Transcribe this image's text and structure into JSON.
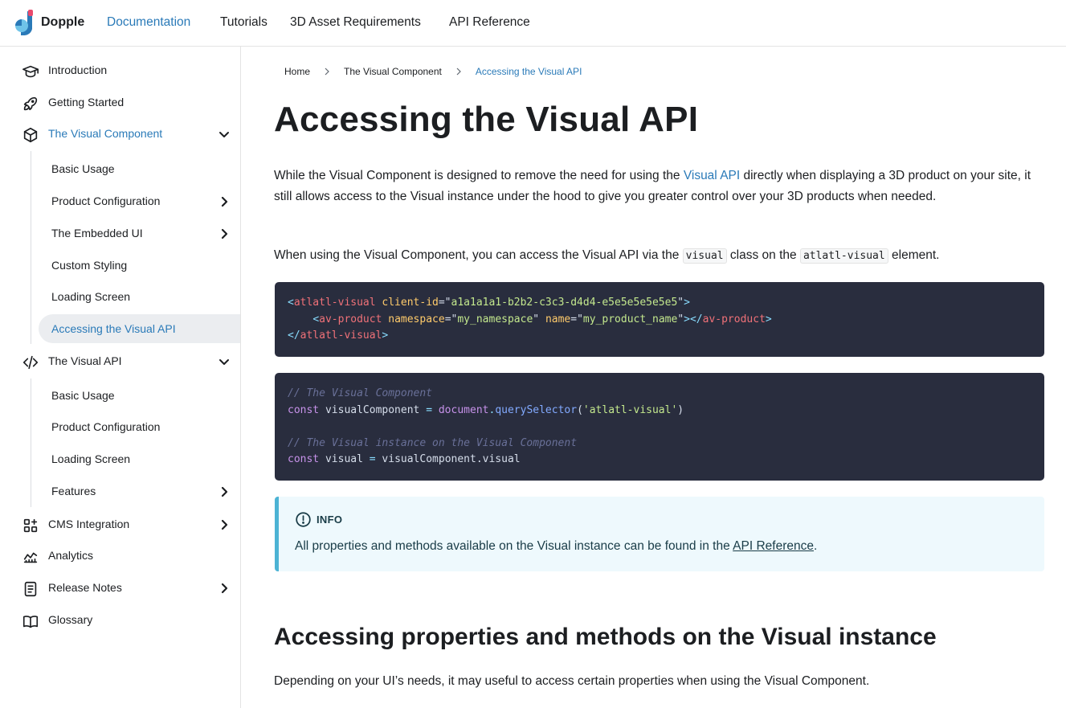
{
  "brand": {
    "name": "Dopple",
    "colors": [
      "#e94a6d",
      "#2a7ab8",
      "#6fc3e8"
    ]
  },
  "nav": {
    "links": [
      {
        "label": "Documentation",
        "active": true
      },
      {
        "label": "Tutorials",
        "active": false
      },
      {
        "label": "3D Asset Requirements",
        "active": false
      },
      {
        "label": "API Reference",
        "active": false
      }
    ]
  },
  "sidebar": {
    "items": [
      {
        "label": "Introduction",
        "icon": "graduation-cap-icon"
      },
      {
        "label": "Getting Started",
        "icon": "rocket-icon"
      },
      {
        "label": "The Visual Component",
        "icon": "cube-icon",
        "expanded": true
      },
      {
        "label": "The Visual API",
        "icon": "code-icon",
        "expanded": true
      },
      {
        "label": "CMS Integration",
        "icon": "apps-plus-icon"
      },
      {
        "label": "Analytics",
        "icon": "chart-line-icon"
      },
      {
        "label": "Release Notes",
        "icon": "document-icon"
      },
      {
        "label": "Glossary",
        "icon": "book-icon"
      }
    ],
    "visual_component_children": [
      {
        "label": "Basic Usage"
      },
      {
        "label": "Product Configuration",
        "has_children": true
      },
      {
        "label": "The Embedded UI",
        "has_children": true
      },
      {
        "label": "Custom Styling"
      },
      {
        "label": "Loading Screen"
      },
      {
        "label": "Accessing the Visual API",
        "active": true
      }
    ],
    "visual_api_children": [
      {
        "label": "Basic Usage"
      },
      {
        "label": "Product Configuration"
      },
      {
        "label": "Loading Screen"
      },
      {
        "label": "Features",
        "has_children": true
      }
    ]
  },
  "breadcrumb": [
    "Home",
    "The Visual Component",
    "Accessing the Visual API"
  ],
  "page": {
    "title": "Accessing the Visual API",
    "p1_before": "While the Visual Component is designed to remove the need for using the ",
    "p1_link": "Visual API",
    "p1_after": " directly when displaying a 3D product on your site, it still allows access to the Visual instance under the hood to give you greater control over your 3D products when needed.",
    "p2_before": "When using the Visual Component, you can access the Visual API via the ",
    "p2_code1": "visual",
    "p2_middle": " class on the ",
    "p2_code2": "atlatl-visual",
    "p2_after": " element.",
    "code1": {
      "tag": "atlatl-visual",
      "attr_client": "client-id",
      "client_id": "a1a1a1a1-b2b2-c3c3-d4d4-e5e5e5e5e5e5",
      "inner_tag": "av-product",
      "attr_ns": "namespace",
      "ns_val": "my_namespace",
      "attr_name": "name",
      "name_val": "my_product_name"
    },
    "code2": {
      "comment1": "// The Visual Component",
      "kw": "const",
      "var1": "visualComponent",
      "obj": "document",
      "method": "querySelector",
      "arg": "'atlatl-visual'",
      "comment2": "// The Visual instance on the Visual Component",
      "var2": "visual",
      "expr": "visualComponent.visual"
    },
    "info": {
      "title": "INFO",
      "before": "All properties and methods available on the Visual instance can be found in the ",
      "link": "API Reference",
      "after": "."
    },
    "h2": "Accessing properties and methods on the Visual instance",
    "p3": "Depending on your UI’s needs, it may useful to access certain properties when using the Visual Component."
  }
}
